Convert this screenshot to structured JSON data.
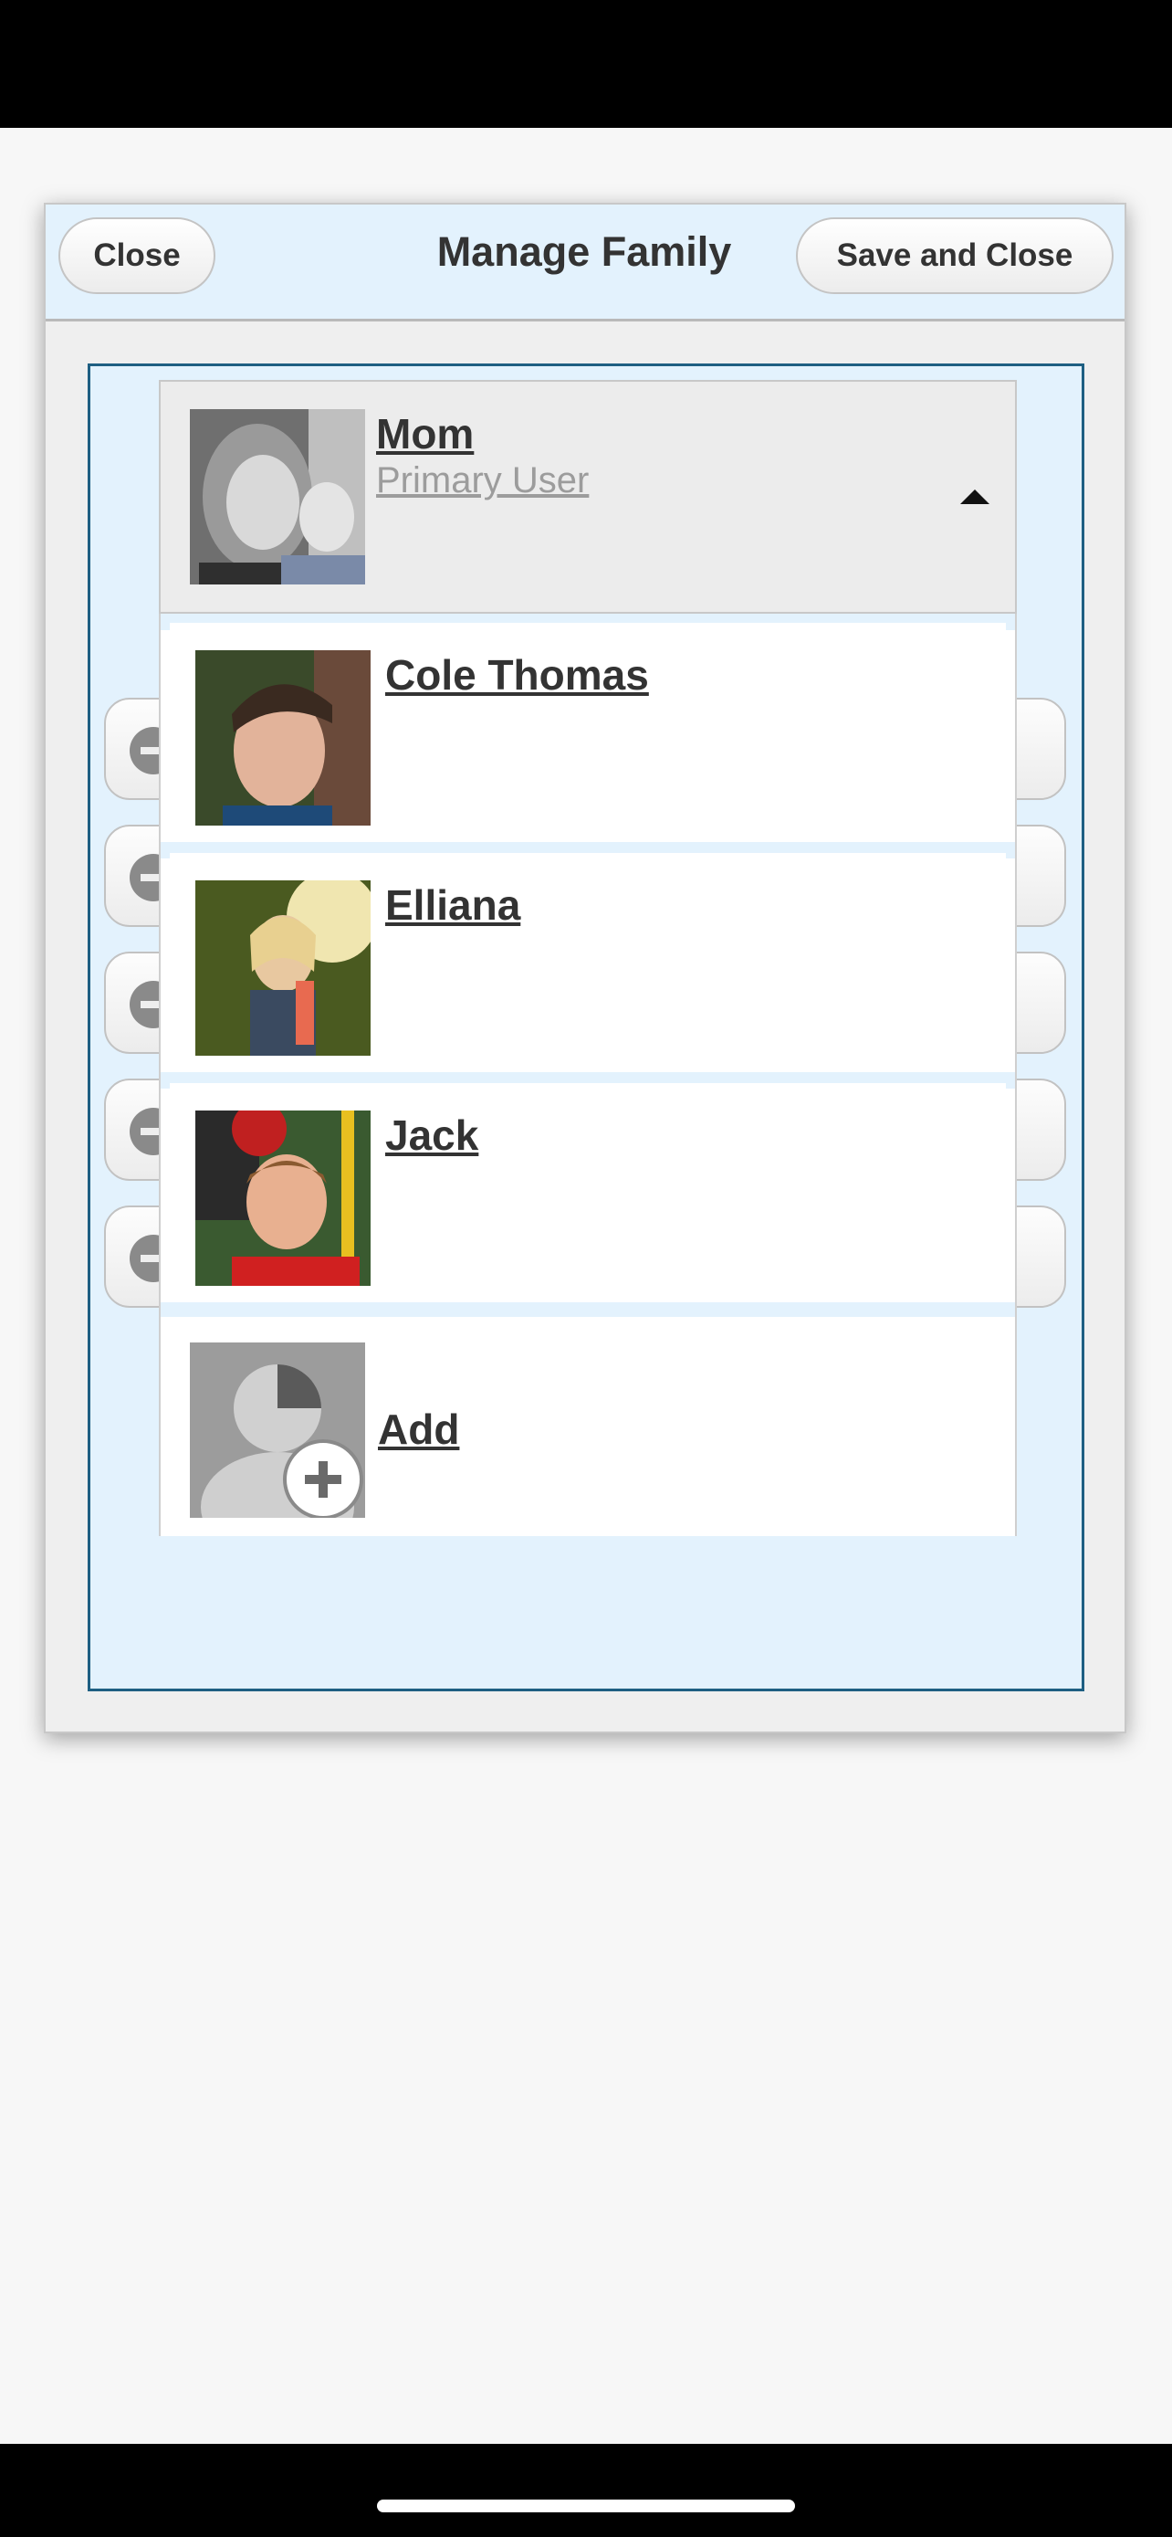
{
  "dialog": {
    "title": "Manage Family",
    "close_label": "Close",
    "save_label": "Save and Close"
  },
  "selected_user": {
    "name": "Mom",
    "role": "Primary User"
  },
  "members": [
    {
      "name": "Cole Thomas"
    },
    {
      "name": "Elliana"
    },
    {
      "name": "Jack"
    }
  ],
  "add": {
    "label": "Add"
  },
  "colors": {
    "header_bg": "#e3f2fd",
    "panel_border": "#1e5f82",
    "text": "#333333",
    "muted_text": "#9c9c9c"
  }
}
